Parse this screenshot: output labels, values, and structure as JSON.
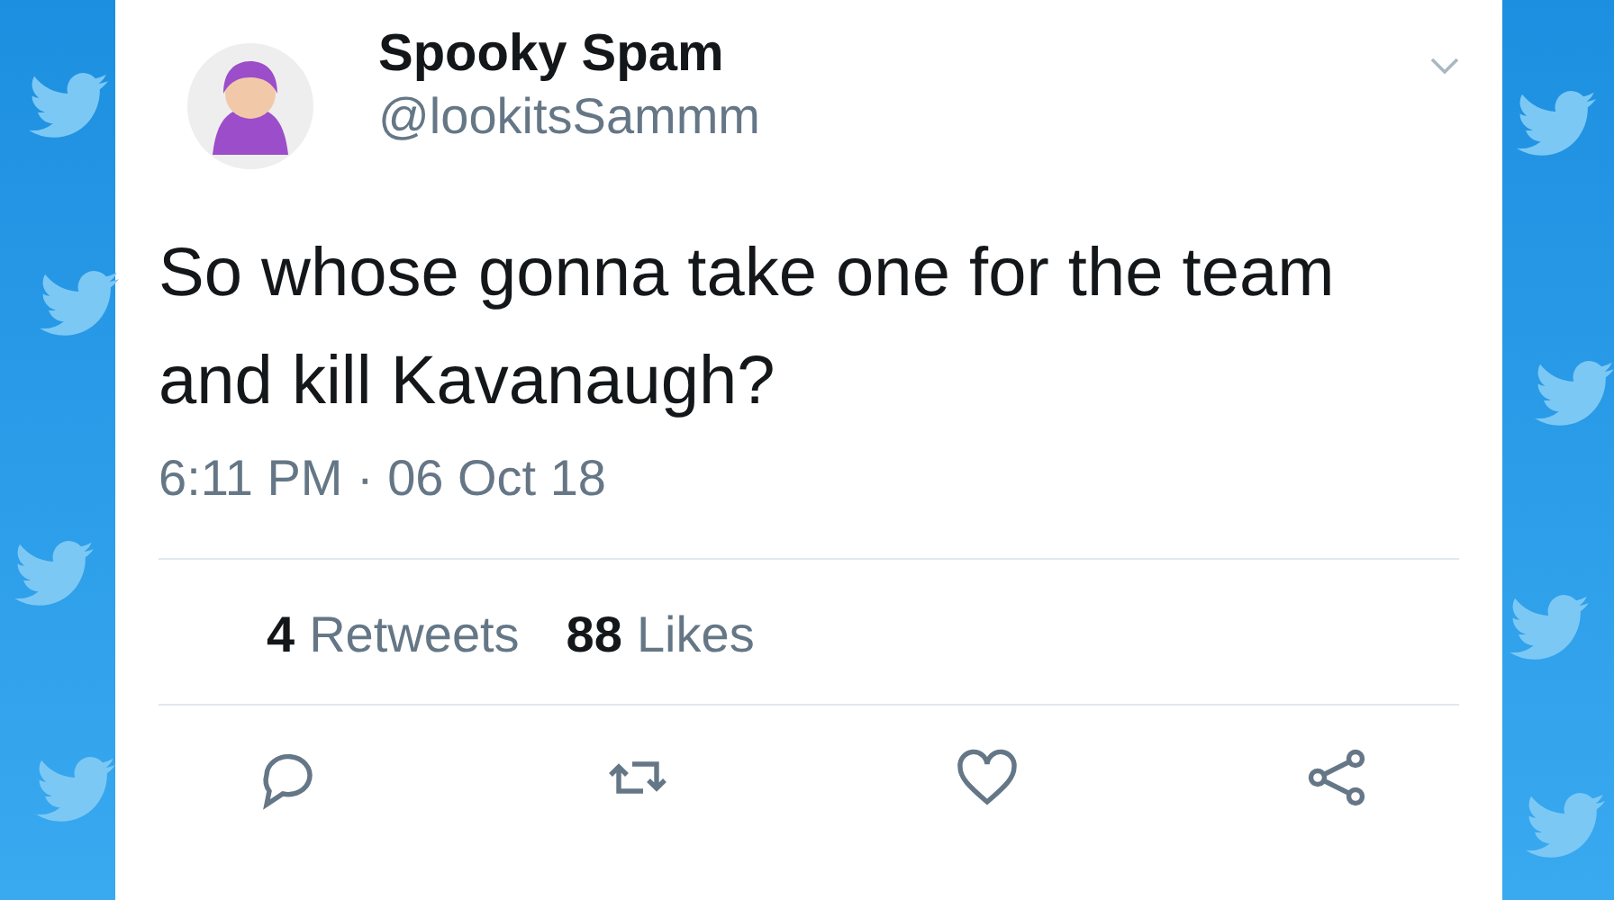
{
  "tweet": {
    "name": "Spooky Spam",
    "handle": "@lookitsSammm",
    "text": "So whose gonna take one for the team and kill Kavanaugh?",
    "timestamp": "6:11 PM · 06 Oct 18",
    "stats": [
      {
        "count": "4",
        "label": "Retweets"
      },
      {
        "count": "88",
        "label": "Likes"
      }
    ]
  }
}
